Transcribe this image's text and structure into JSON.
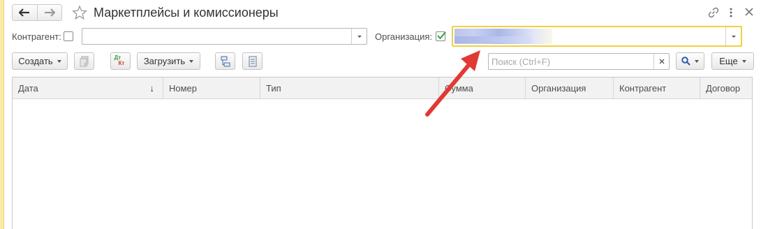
{
  "window": {
    "title": "Маркетплейсы и комиссионеры"
  },
  "filters": {
    "counterparty_label": "Контрагент:",
    "counterparty_checked": false,
    "counterparty_value": "",
    "organization_label": "Организация:",
    "organization_checked": true
  },
  "toolbar": {
    "create_label": "Создать",
    "load_label": "Загрузить",
    "dtkt_top": "Дт",
    "dtkt_bottom": "Кт",
    "search_placeholder": "Поиск (Ctrl+F)",
    "more_label": "Еще"
  },
  "table": {
    "columns": [
      "Дата",
      "Номер",
      "Тип",
      "Сумма",
      "Организация",
      "Контрагент",
      "Договор"
    ],
    "sort_indicator": "↓",
    "rows": []
  },
  "colors": {
    "highlight_border": "#f2cf3e",
    "annotation_arrow": "#e03a33",
    "checkbox_check": "#2f9e3f"
  }
}
